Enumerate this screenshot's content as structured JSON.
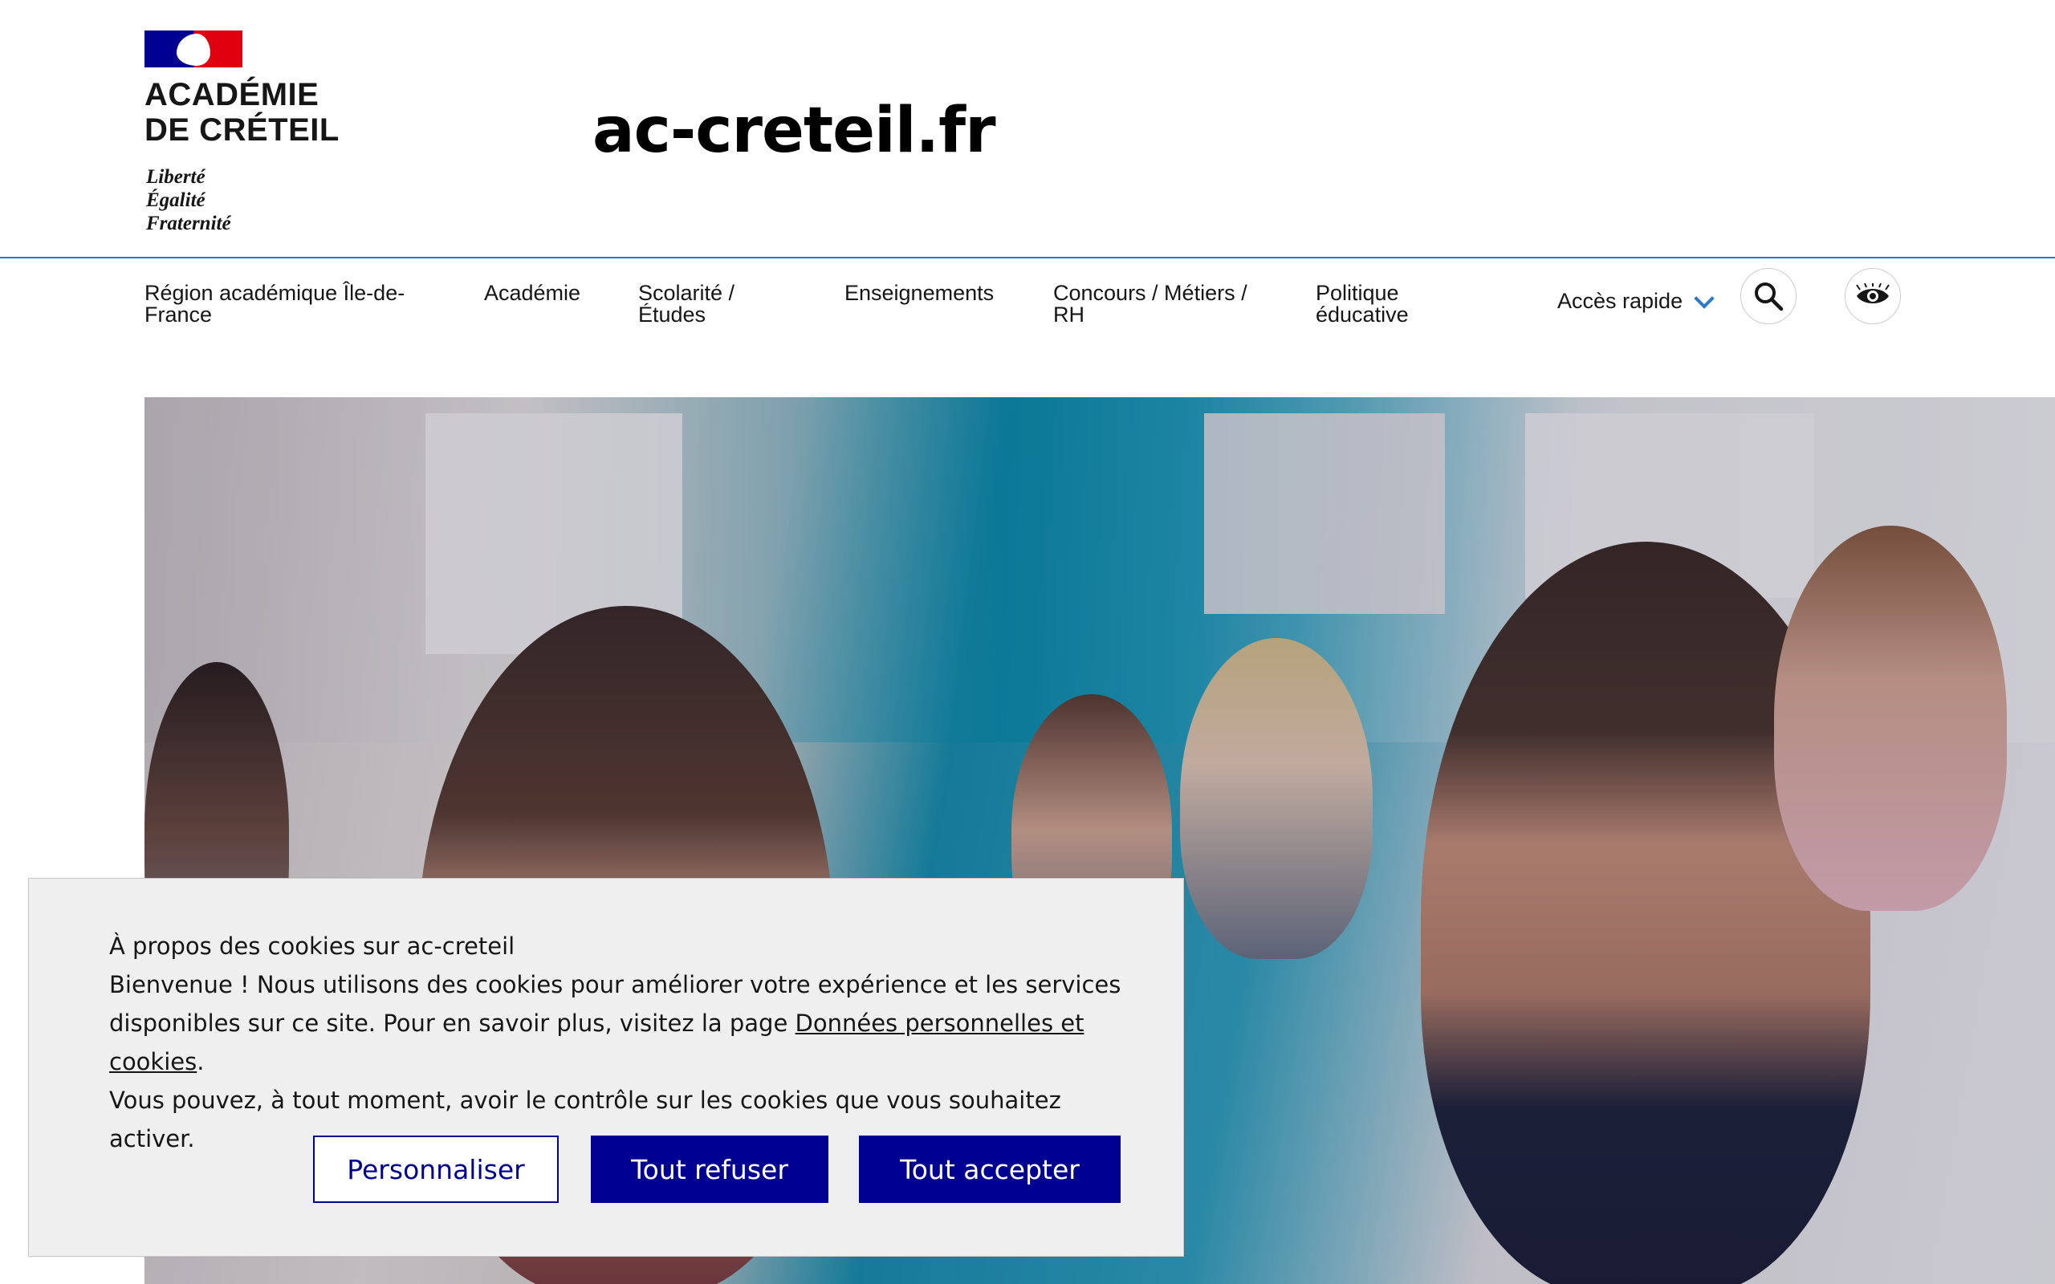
{
  "header": {
    "logo_line1": "ACADÉMIE",
    "logo_line2": "DE CRÉTEIL",
    "motto_line1": "Liberté",
    "motto_line2": "Égalité",
    "motto_line3": "Fraternité",
    "site_name": "ac-creteil.fr"
  },
  "nav": {
    "items": [
      {
        "line1": "Région académique Île-de-",
        "line2": "France"
      },
      {
        "line1": "Académie",
        "line2": ""
      },
      {
        "line1": "Scolarité /",
        "line2": "Études"
      },
      {
        "line1": "Enseignements",
        "line2": ""
      },
      {
        "line1": "Concours / Métiers /",
        "line2": "RH"
      },
      {
        "line1": "Politique",
        "line2": "éducative"
      }
    ],
    "quick_access": "Accès rapide",
    "search_icon": "search-icon",
    "accessibility_icon": "eye-icon"
  },
  "cookie": {
    "title": "À propos des cookies sur ac-creteil",
    "text_before_link": "Bienvenue ! Nous utilisons des cookies pour améliorer votre expérience et les services disponibles sur ce site. Pour en savoir plus, visitez la page ",
    "link": "Données personnelles et cookies",
    "text_after_link": ".",
    "text_line4": "Vous pouvez, à tout moment, avoir le contrôle sur les cookies que vous souhaitez activer.",
    "customize": "Personnaliser",
    "refuse_all": "Tout refuser",
    "accept_all": "Tout accepter"
  },
  "colors": {
    "brand_blue": "#000091",
    "brand_red": "#e1000f",
    "accent_blue": "#2e78c7"
  }
}
